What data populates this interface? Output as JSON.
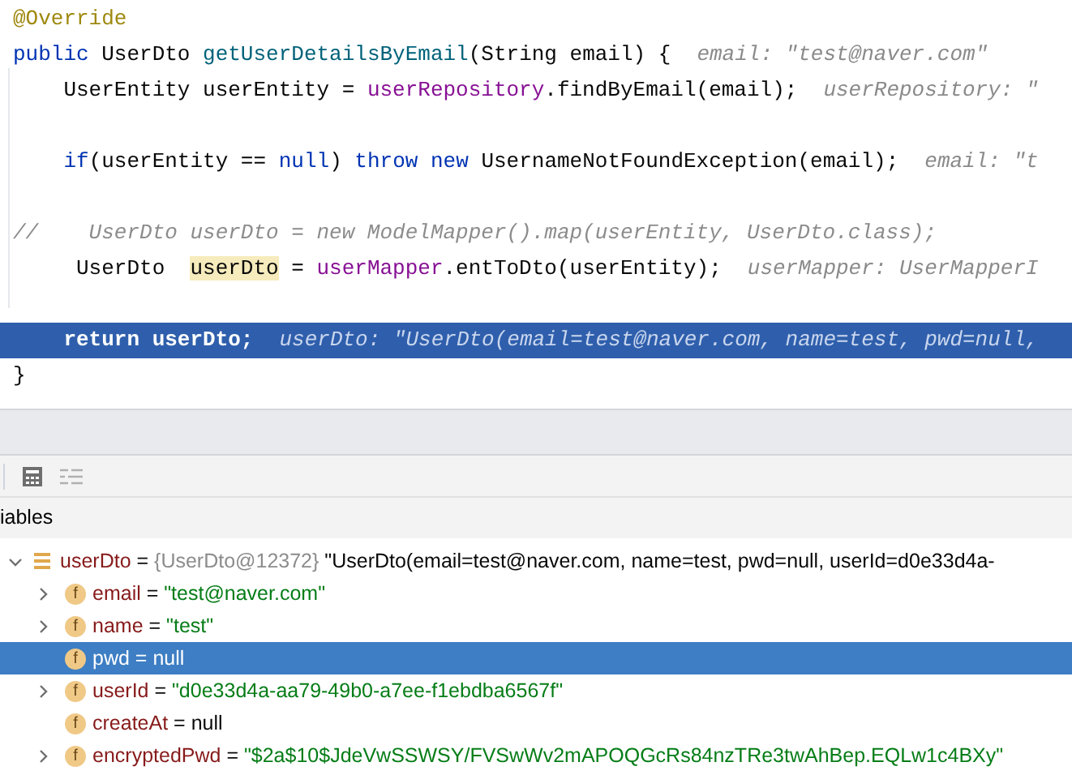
{
  "code": {
    "lines": [
      {
        "kind": "code",
        "current": false,
        "tokens": [
          {
            "t": "@Override",
            "kind": "annotation"
          }
        ]
      },
      {
        "kind": "code",
        "current": false,
        "tokens": [
          {
            "t": "public ",
            "kind": "keyword"
          },
          {
            "t": "UserDto ",
            "kind": "plain"
          },
          {
            "t": "getUserDetailsByEmail",
            "kind": "method"
          },
          {
            "t": "(String email) {",
            "kind": "plain"
          }
        ],
        "hint": "email: \"test@naver.com\""
      },
      {
        "kind": "code",
        "current": false,
        "tokens": [
          {
            "t": "    UserEntity userEntity = ",
            "kind": "plain"
          },
          {
            "t": "userRepository",
            "kind": "field"
          },
          {
            "t": ".findByEmail(email);",
            "kind": "plain"
          }
        ],
        "hint": "userRepository: \""
      },
      {
        "kind": "blank",
        "current": false
      },
      {
        "kind": "code",
        "current": false,
        "tokens": [
          {
            "t": "    if",
            "kind": "keyword"
          },
          {
            "t": "(userEntity == ",
            "kind": "plain"
          },
          {
            "t": "null",
            "kind": "keyword"
          },
          {
            "t": ") ",
            "kind": "plain"
          },
          {
            "t": "throw new ",
            "kind": "keyword"
          },
          {
            "t": "UsernameNotFoundException(email);",
            "kind": "plain"
          }
        ],
        "hint": "email: \"t"
      },
      {
        "kind": "blank",
        "current": false
      },
      {
        "kind": "code",
        "current": false,
        "tokens": [
          {
            "t": "//    UserDto userDto = new ModelMapper().map(userEntity, UserDto.class);",
            "kind": "comment"
          }
        ]
      },
      {
        "kind": "code",
        "current": false,
        "tokens": [
          {
            "t": "     UserDto  ",
            "kind": "plain"
          },
          {
            "t": "userDto",
            "kind": "usage"
          },
          {
            "t": " = ",
            "kind": "plain"
          },
          {
            "t": "userMapper",
            "kind": "field"
          },
          {
            "t": ".entToDto(userEntity);",
            "kind": "plain"
          }
        ],
        "hint": "userMapper: UserMapperI"
      },
      {
        "kind": "blank",
        "current": false
      },
      {
        "kind": "code",
        "current": true,
        "tokens": [
          {
            "t": "    return userDto;",
            "kind": "keyword"
          }
        ],
        "hint": "userDto: \"UserDto(email=test@naver.com, name=test, pwd=null,"
      },
      {
        "kind": "code",
        "current": false,
        "tokens": [
          {
            "t": "}",
            "kind": "plain"
          }
        ]
      }
    ]
  },
  "debugger": {
    "tab": "iables",
    "variables": [
      {
        "kind": "object",
        "name": "userDto",
        "operator": "=",
        "ref": "{UserDto@12372}",
        "value": "\"UserDto(email=test@naver.com, name=test, pwd=null, userId=d0e33d4a-",
        "is_string": false,
        "expanded": true,
        "selected": false,
        "children": [
          {
            "kind": "object",
            "name": "email",
            "icon": "f",
            "operator": "=",
            "value": "\"test@naver.com\"",
            "is_string": true,
            "expanded": false,
            "selected": false
          },
          {
            "kind": "object",
            "name": "name",
            "icon": "f",
            "operator": "=",
            "value": "\"test\"",
            "is_string": true,
            "expanded": false,
            "selected": false
          },
          {
            "kind": "leaf",
            "name": "pwd",
            "icon": "f",
            "operator": "=",
            "value": "null",
            "is_string": false,
            "selected": true
          },
          {
            "kind": "object",
            "name": "userId",
            "icon": "f",
            "operator": "=",
            "value": "\"d0e33d4a-aa79-49b0-a7ee-f1ebdba6567f\"",
            "is_string": true,
            "expanded": false,
            "selected": false
          },
          {
            "kind": "leaf",
            "name": "createAt",
            "icon": "f",
            "operator": "=",
            "value": "null",
            "is_string": false,
            "selected": false
          },
          {
            "kind": "object",
            "name": "encryptedPwd",
            "icon": "f",
            "operator": "=",
            "value": "\"$2a$10$JdeVwSSWSY/FVSwWv2mAPOQGcRs84nzTRe3twAhBep.EQLw1c4BXy\"",
            "is_string": true,
            "expanded": false,
            "selected": false
          }
        ]
      }
    ]
  }
}
